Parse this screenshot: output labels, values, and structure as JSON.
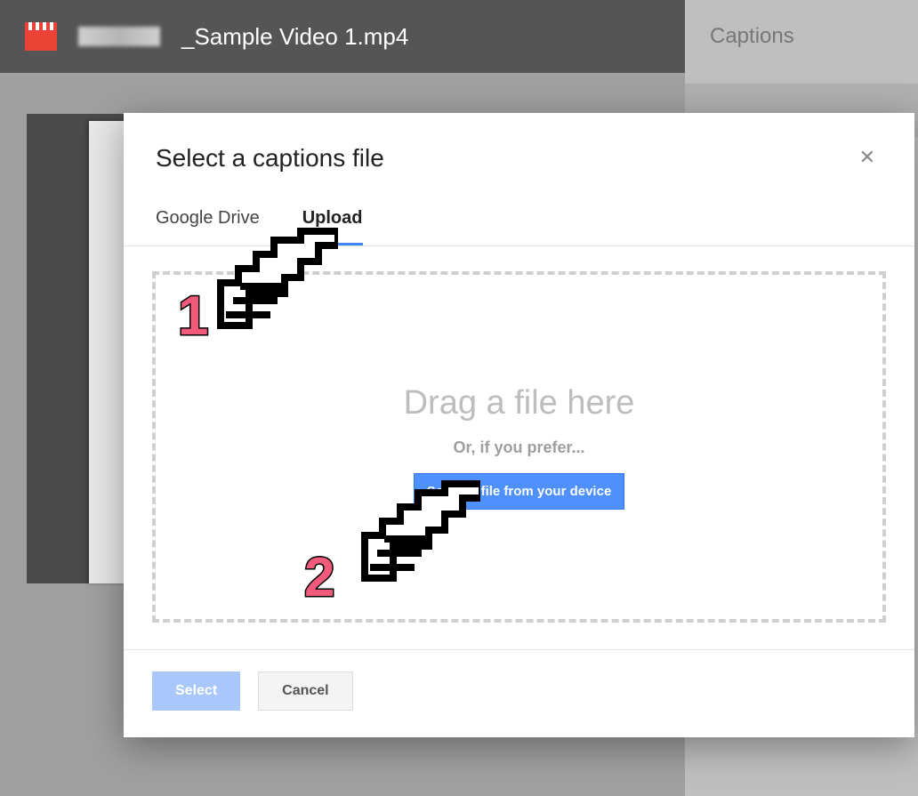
{
  "background": {
    "filename": "_Sample Video 1.mp4",
    "sidepanel_title": "Captions"
  },
  "modal": {
    "title": "Select a captions file",
    "tabs": {
      "drive": "Google Drive",
      "upload": "Upload"
    },
    "dropzone": {
      "drag_text": "Drag a file here",
      "or_text": "Or, if you prefer...",
      "pick_button": "Select a file from your device"
    },
    "footer": {
      "select": "Select",
      "cancel": "Cancel"
    }
  },
  "annotations": {
    "step1": "1",
    "step2": "2"
  }
}
